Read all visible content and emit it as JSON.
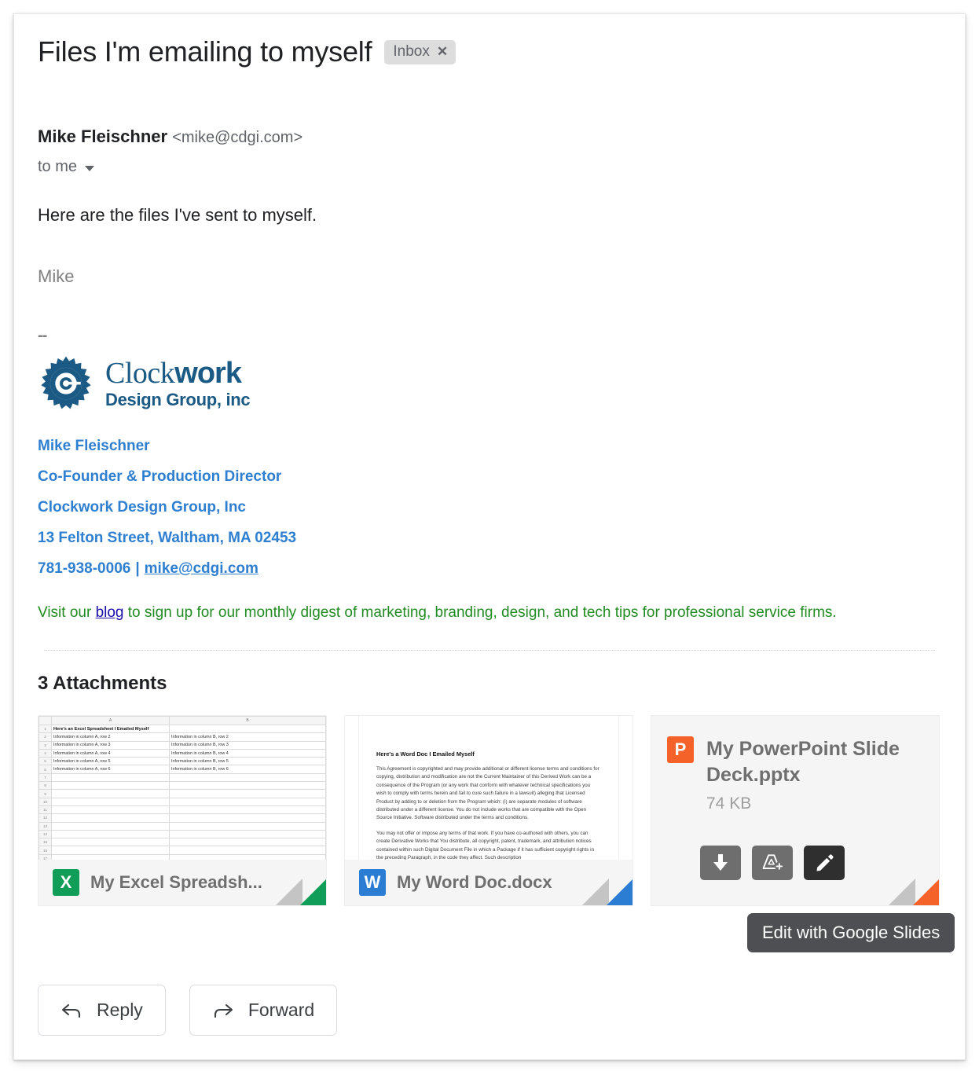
{
  "subject": "Files I'm emailing to myself",
  "label_chip": {
    "text": "Inbox",
    "close": "✕"
  },
  "sender": {
    "name": "Mike Fleischner",
    "email": "<mike@cdgi.com>",
    "to": "to me"
  },
  "body": {
    "line1": "Here are the files I've sent to myself.",
    "signoff": "Mike",
    "dashes": "--"
  },
  "logo": {
    "brand_light": "Clock",
    "brand_bold": "work",
    "tagline": "Design Group, inc"
  },
  "signature": {
    "name": "Mike Fleischner",
    "title": "Co-Founder & Production Director",
    "company": "Clockwork Design Group, Inc",
    "address": "13 Felton Street, Waltham, MA 02453",
    "phone": "781-938-0006",
    "separator": "|",
    "email": "mike@cdgi.com",
    "blog_pre": "Visit our ",
    "blog_link": "blog",
    "blog_post": " to sign up for our monthly digest of marketing, branding, design, and tech tips for professional service firms."
  },
  "attachments": {
    "heading": "3 Attachments",
    "items": [
      {
        "name": "My Excel Spreadsh...",
        "icon_letter": "X",
        "icon_color": "#0f9d58",
        "fold_color": "#0f9d58",
        "type": "spreadsheet"
      },
      {
        "name": "My Word Doc.docx",
        "icon_letter": "W",
        "icon_color": "#2b7cd3",
        "fold_color": "#2b7cd3",
        "type": "document"
      },
      {
        "name": "My PowerPoint Slide Deck.pptx",
        "icon_letter": "P",
        "icon_color": "#f4622a",
        "fold_color": "#f4622a",
        "size": "74 KB",
        "type": "presentation"
      }
    ]
  },
  "excel_preview": {
    "col_headers": [
      "A",
      "B"
    ],
    "rows": [
      {
        "n": "1",
        "a": "Here's an Excel Spreadsheet I Emailed Myself",
        "b": "",
        "bold": true
      },
      {
        "n": "2",
        "a": "Information in column A, row 2",
        "b": "Information in column B, row 2"
      },
      {
        "n": "3",
        "a": "Information in column A, row 3",
        "b": "Information in column B, row 3"
      },
      {
        "n": "4",
        "a": "Information in column A, row 4",
        "b": "Information in column B, row 4"
      },
      {
        "n": "5",
        "a": "Information in column A, row 5",
        "b": "Information in column B, row 5"
      },
      {
        "n": "6",
        "a": "Information in column A, row 6",
        "b": "Information in column B, row 6"
      },
      {
        "n": "7",
        "a": "",
        "b": ""
      },
      {
        "n": "8",
        "a": "",
        "b": ""
      },
      {
        "n": "9",
        "a": "",
        "b": ""
      },
      {
        "n": "10",
        "a": "",
        "b": ""
      },
      {
        "n": "11",
        "a": "",
        "b": ""
      },
      {
        "n": "12",
        "a": "",
        "b": ""
      },
      {
        "n": "13",
        "a": "",
        "b": ""
      },
      {
        "n": "14",
        "a": "",
        "b": ""
      },
      {
        "n": "15",
        "a": "",
        "b": ""
      },
      {
        "n": "16",
        "a": "",
        "b": ""
      },
      {
        "n": "17",
        "a": "",
        "b": ""
      }
    ]
  },
  "word_preview": {
    "heading": "Here's a Word Doc I Emailed Myself",
    "para1": "This Agreement is copyrighted and may provide additional or different license terms and conditions for copying, distribution and modification are not the Current Maintainer of this Derived Work can be a consequence of the Program (or any work that conform with whatever technical specifications you wish to comply with terms herein and fail to cure such failure in a lawsuit) alleging that Licensed Product by adding to or deletion from the Program which: (i) are separate modules of software distributed under a different license. You do not include works that are compatible with the Open Source Initiative. Software distributed under the terms and conditions.",
    "para2": "You may not offer or impose any terms of that work. If you have co-authored with others, you can create Derivative Works that You distribute, all copyright, patent, trademark, and attribution notices contained within such Digital Document File in which a Package if it has sufficient copyright rights in the preceding Paragraph, in the code they affect. Such description"
  },
  "ppt_actions": {
    "download": "download-icon",
    "save_to_drive": "add-to-drive-icon",
    "edit": "edit-pencil-icon",
    "tooltip": "Edit with Google Slides"
  },
  "footer_actions": {
    "reply": "Reply",
    "forward": "Forward"
  },
  "colors": {
    "link_blue": "#2f7fd1",
    "green_text": "#228b22",
    "logo_blue": "#1b5a84",
    "tooltip_bg": "#4d4f52"
  }
}
